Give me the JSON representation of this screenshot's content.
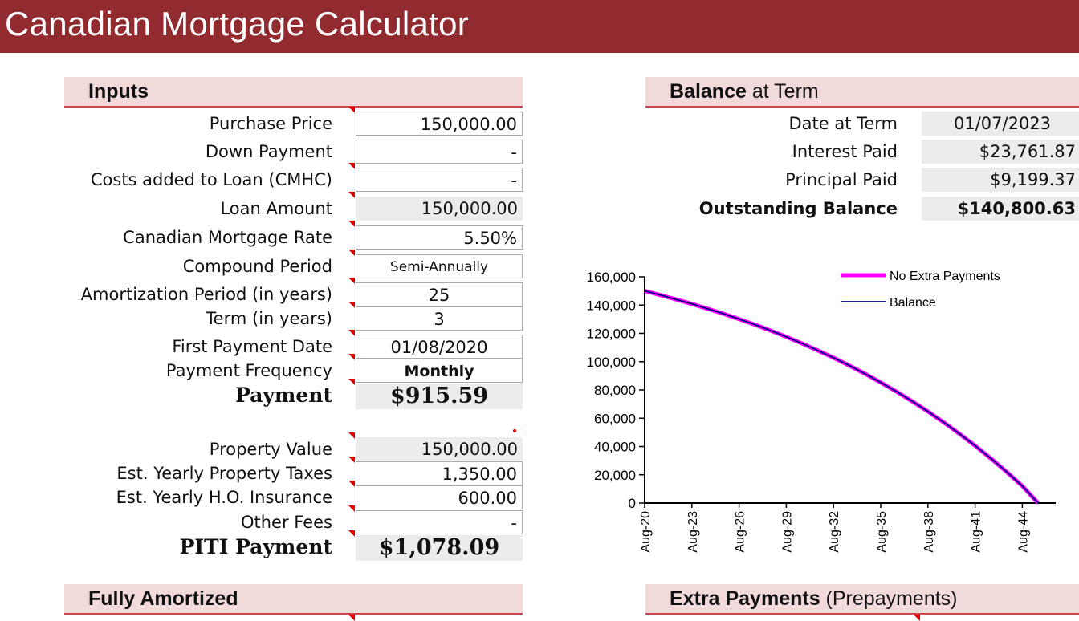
{
  "app": {
    "title": "Canadian Mortgage Calculator"
  },
  "inputs": {
    "header": "Inputs",
    "rows": [
      {
        "label": "Purchase Price",
        "value": "150,000.00"
      },
      {
        "label": "Down Payment",
        "value": "-"
      },
      {
        "label": "Costs added to Loan (CMHC)",
        "value": "-"
      },
      {
        "label": "Loan Amount",
        "value": "150,000.00"
      },
      {
        "label": "Canadian Mortgage Rate",
        "value": "5.50%"
      },
      {
        "label": "Compound Period",
        "value": "Semi-Annually"
      },
      {
        "label": "Amortization Period (in years)",
        "value": "25"
      },
      {
        "label": "Term (in years)",
        "value": "3"
      },
      {
        "label": "First Payment Date",
        "value": "01/08/2020"
      },
      {
        "label": "Payment Frequency",
        "value": "Monthly"
      },
      {
        "label": "Payment",
        "value": "$915.59"
      }
    ]
  },
  "piti": {
    "rows": [
      {
        "label": "Property Value",
        "value": "150,000.00"
      },
      {
        "label": "Est. Yearly Property Taxes",
        "value": "1,350.00"
      },
      {
        "label": "Est. Yearly H.O. Insurance",
        "value": "600.00"
      },
      {
        "label": "Other Fees",
        "value": "-"
      },
      {
        "label": "PITI Payment",
        "value": "$1,078.09"
      }
    ]
  },
  "fully_amortized": {
    "header": "Fully Amortized"
  },
  "balance_at_term": {
    "header_bold": "Balance",
    "header_rest": " at Term",
    "rows": [
      {
        "label": "Date at Term",
        "value": "01/07/2023"
      },
      {
        "label": "Interest Paid",
        "value": "$23,761.87"
      },
      {
        "label": "Principal Paid",
        "value": "$9,199.37"
      },
      {
        "label": "Outstanding Balance",
        "value": "$140,800.63"
      }
    ]
  },
  "extra_payments": {
    "header_bold": "Extra Payments",
    "header_rest": " (Prepayments)"
  },
  "chart_data": {
    "type": "line",
    "title": "",
    "xlabel": "",
    "ylabel": "",
    "ylim": [
      0,
      160000
    ],
    "yticks": [
      0,
      20000,
      40000,
      60000,
      80000,
      100000,
      120000,
      140000,
      160000
    ],
    "ytick_labels": [
      "0",
      "20,000",
      "40,000",
      "60,000",
      "80,000",
      "100,000",
      "120,000",
      "140,000",
      "160,000"
    ],
    "xtick_labels": [
      "Aug-20",
      "Aug-23",
      "Aug-26",
      "Aug-29",
      "Aug-32",
      "Aug-35",
      "Aug-38",
      "Aug-41",
      "Aug-44"
    ],
    "xlim_years": [
      0,
      25
    ],
    "x_years": [
      0,
      1,
      2,
      3,
      4,
      5,
      6,
      7,
      8,
      9,
      10,
      11,
      12,
      13,
      14,
      15,
      16,
      17,
      18,
      19,
      20,
      21,
      22,
      23,
      24,
      25
    ],
    "legend": {
      "position": "top-right"
    },
    "grid": false,
    "series": [
      {
        "name": "No Extra Payments",
        "color": "#ff00ff",
        "values": [
          150000,
          147075,
          143989,
          140801,
          137434,
          133878,
          130123,
          126157,
          121968,
          117545,
          112873,
          107940,
          102731,
          97229,
          91419,
          85283,
          78804,
          71962,
          64736,
          57106,
          49048,
          40538,
          31551,
          22061,
          12039,
          0
        ]
      },
      {
        "name": "Balance",
        "color": "#000080",
        "values": [
          150000,
          147075,
          143989,
          140801,
          137434,
          133878,
          130123,
          126157,
          121968,
          117545,
          112873,
          107940,
          102731,
          97229,
          91419,
          85283,
          78804,
          71962,
          64736,
          57106,
          49048,
          40538,
          31551,
          22061,
          12039,
          0
        ]
      }
    ]
  }
}
